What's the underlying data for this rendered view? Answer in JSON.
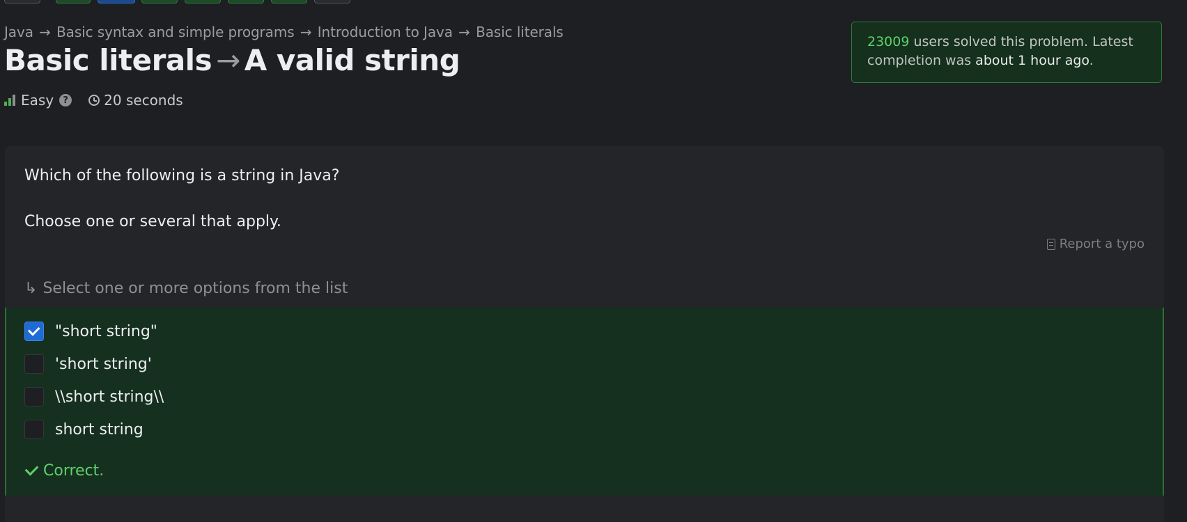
{
  "breadcrumb": {
    "items": [
      "Java",
      "Basic syntax and simple programs",
      "Introduction to Java",
      "Basic literals"
    ],
    "separator": "→"
  },
  "title": {
    "topic": "Basic literals",
    "arrow": "→",
    "problem": "A valid string"
  },
  "meta": {
    "difficulty": "Easy",
    "help": "?",
    "time": "20 seconds"
  },
  "stats": {
    "count": "23009",
    "text_after_count": " users solved this problem. Latest completion was ",
    "latest": "about 1 hour ago",
    "end": "."
  },
  "question": {
    "text": "Which of the following is a string in Java?",
    "instruction": "Choose one or several that apply.",
    "report_label": "Report a typo",
    "hint": "Select one or more options from the list",
    "options": [
      {
        "label": "\"short string\"",
        "checked": true
      },
      {
        "label": "'short string'",
        "checked": false
      },
      {
        "label": "\\\\short string\\\\",
        "checked": false
      },
      {
        "label": "short string",
        "checked": false
      }
    ],
    "result": "Correct."
  },
  "colors": {
    "accent_green": "#5fcf6a",
    "checkbox_blue": "#1f6bd6",
    "panel_green": "#163020"
  }
}
